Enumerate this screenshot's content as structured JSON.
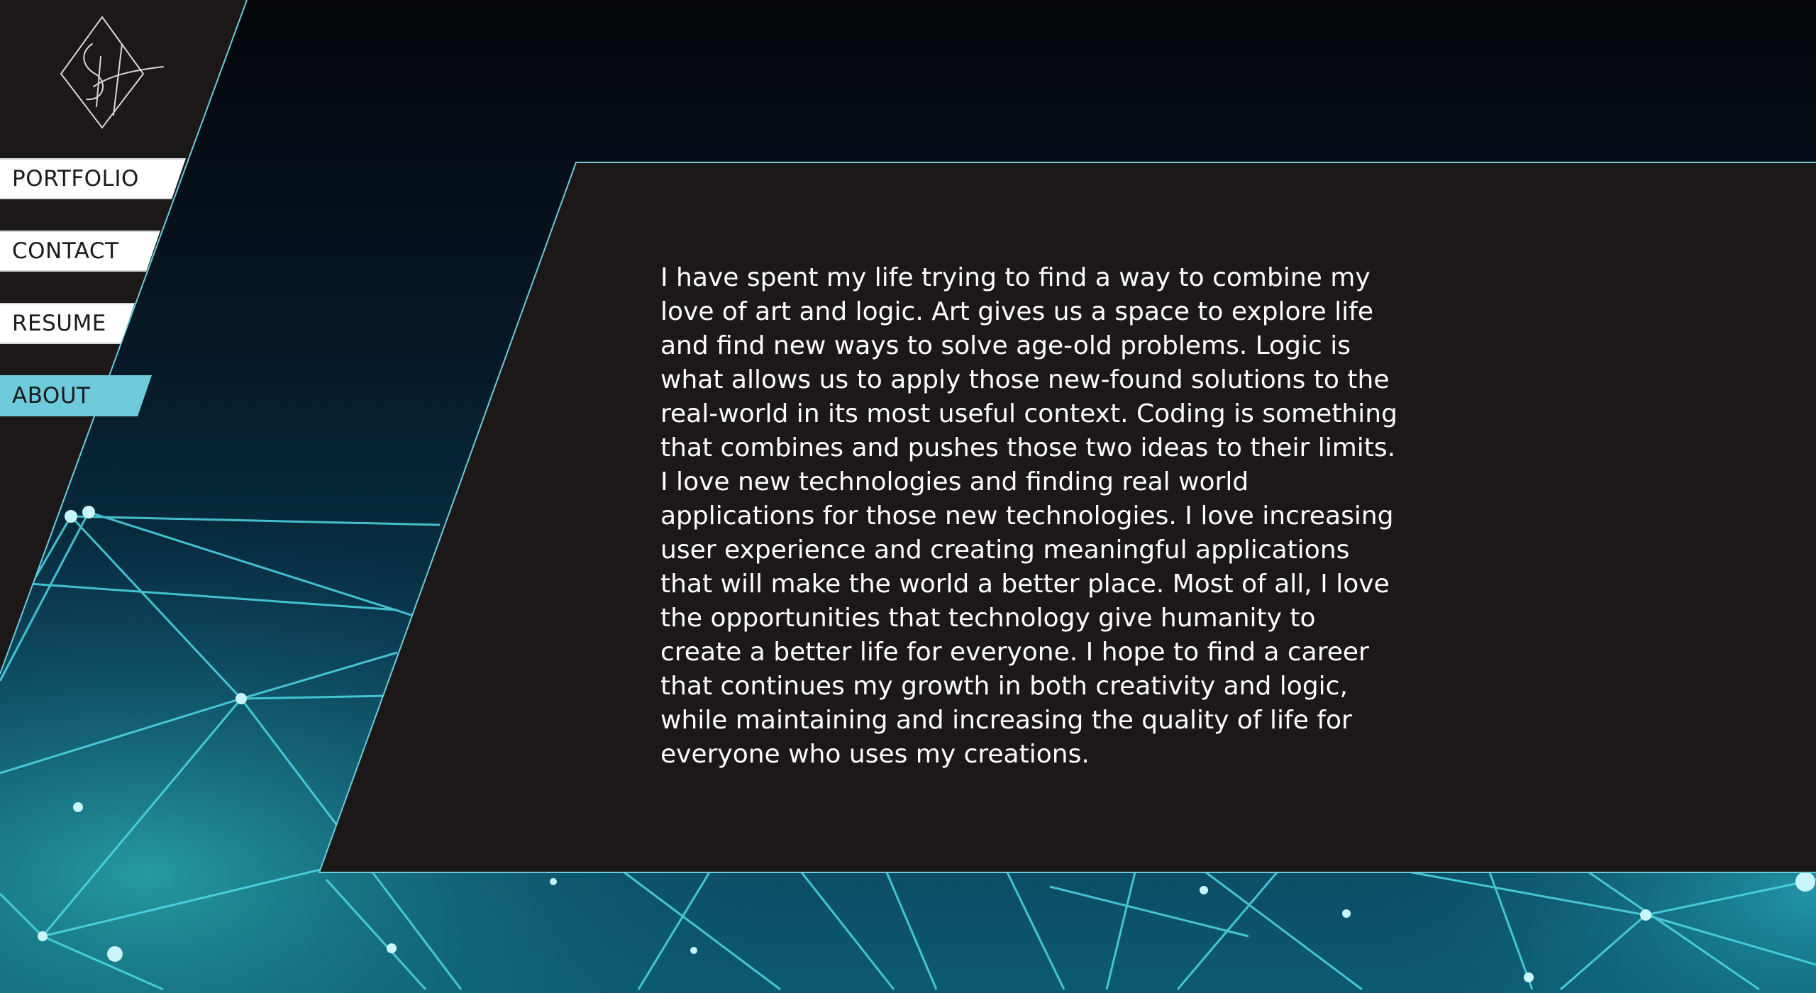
{
  "logo": {
    "icon": "signature-diamond-logo",
    "alt": "SH"
  },
  "nav": {
    "items": [
      {
        "label": "PORTFOLIO",
        "active": false
      },
      {
        "label": "CONTACT",
        "active": false
      },
      {
        "label": "RESUME",
        "active": false
      },
      {
        "label": "ABOUT",
        "active": true
      }
    ]
  },
  "about": {
    "text": "I have spent my life trying to find a way to combine my love of art and logic. Art gives us a space to explore life and find new ways to solve age-old problems. Logic is what allows us to apply those new-found solutions to the real-world in its most useful context. Coding is something that combines and pushes those two ideas to their limits. I love new technologies and finding real world applications for those new technologies. I love increasing user experience and creating meaningful applications that will make the world a better place. Most of all, I love the opportunities that technology give humanity to create a better life for everyone. I hope to find a career that continues my growth in both creativity and logic, while maintaining and increasing the quality of life for everyone who uses my creations."
  },
  "colors": {
    "panel": "#1c1818",
    "accent": "#6dcbdb",
    "background_top": "#05070b",
    "background_bottom": "#0c4a63",
    "network_lines": "#4fd9e6"
  }
}
